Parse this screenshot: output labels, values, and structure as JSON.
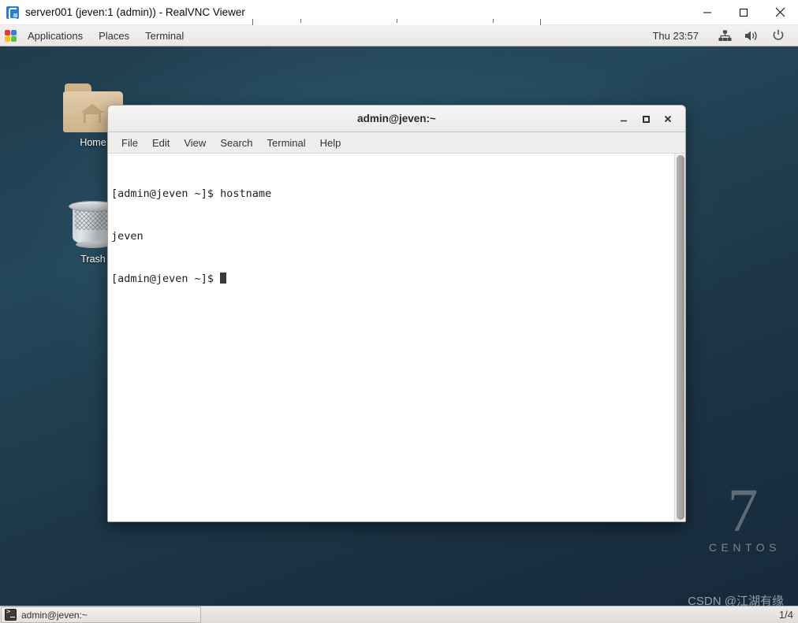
{
  "vnc_window": {
    "title": "server001 (jeven:1 (admin)) - RealVNC Viewer",
    "app_icon": "realvnc-icon",
    "buttons": {
      "minimize": "minimize-icon",
      "maximize": "maximize-icon",
      "close": "close-icon"
    },
    "toolbar_handle": "vnc-toolbar-handle"
  },
  "desktop": {
    "panel": {
      "apps_icon": "applications-icon",
      "menus": [
        "Applications",
        "Places",
        "Terminal"
      ],
      "clock": "Thu 23:57",
      "tray_icons": [
        "network-icon",
        "volume-icon",
        "power-icon"
      ]
    },
    "icons": [
      {
        "name": "home-folder-icon",
        "label": "Home"
      },
      {
        "name": "trash-icon",
        "label": "Trash"
      }
    ],
    "watermark": {
      "version": "7",
      "brand": "CENTOS"
    },
    "csdn_watermark": "CSDN @江湖有缘",
    "taskbar": {
      "window_button": {
        "icon": "terminal-icon",
        "label": "admin@jeven:~"
      },
      "workspace": "1/4"
    }
  },
  "terminal": {
    "title": "admin@jeven:~",
    "menus": [
      "File",
      "Edit",
      "View",
      "Search",
      "Terminal",
      "Help"
    ],
    "buttons": {
      "minimize": "minimize-icon",
      "maximize": "maximize-icon",
      "close": "close-icon"
    },
    "lines": [
      "[admin@jeven ~]$ hostname",
      "jeven"
    ],
    "prompt": "[admin@jeven ~]$ ",
    "command": "hostname",
    "output": "jeven",
    "scrollbar": "vertical-scrollbar"
  },
  "colors": {
    "desktop_bg": "#1f3b4d",
    "terminal_bg": "#ffffff",
    "terminal_fg": "#1d1d1d",
    "panel_bg": "#f2f1f0",
    "vnc_titlebar_bg": "#ffffff"
  }
}
